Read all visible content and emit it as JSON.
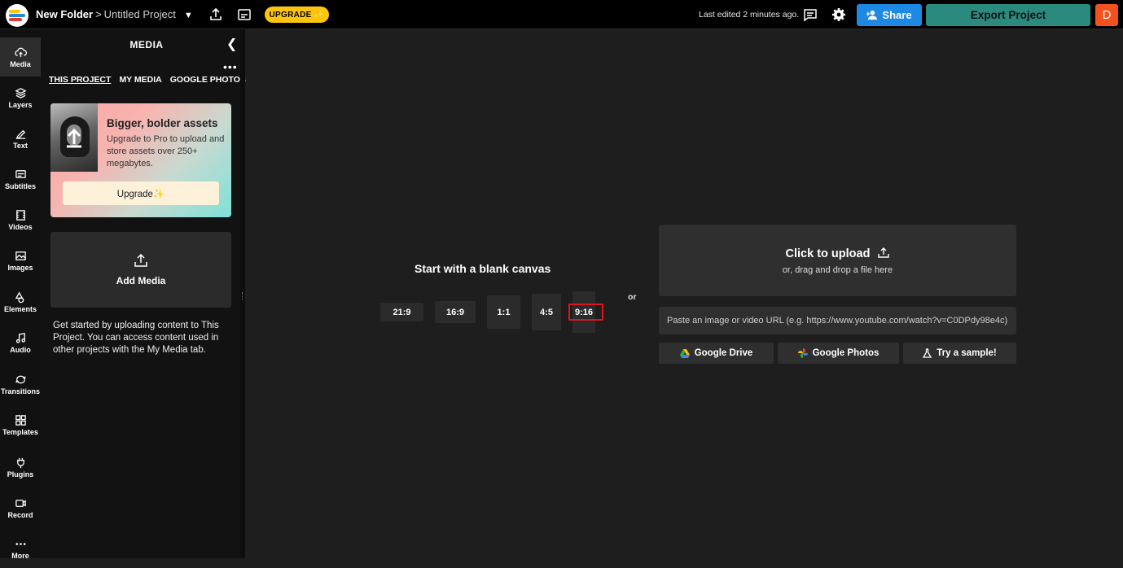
{
  "header": {
    "folder": "New Folder",
    "separator": ">",
    "project": "Untitled Project",
    "upgrade_label": "UPGRADE ✨",
    "last_edited": "Last edited 2 minutes ago.",
    "share_label": "Share",
    "export_label": "Export Project",
    "avatar_initial": "D",
    "colors": {
      "upgrade": "#ffc40c",
      "share": "#1e88e5",
      "export": "#2a8a7e",
      "avatar": "#f4511e"
    }
  },
  "rail": [
    {
      "label": "Media",
      "icon": "media-icon"
    },
    {
      "label": "Layers",
      "icon": "layers-icon"
    },
    {
      "label": "Text",
      "icon": "text-icon"
    },
    {
      "label": "Subtitles",
      "icon": "subtitles-icon"
    },
    {
      "label": "Videos",
      "icon": "videos-icon"
    },
    {
      "label": "Images",
      "icon": "images-icon"
    },
    {
      "label": "Elements",
      "icon": "elements-icon"
    },
    {
      "label": "Audio",
      "icon": "audio-icon"
    },
    {
      "label": "Transitions",
      "icon": "transitions-icon"
    },
    {
      "label": "Templates",
      "icon": "templates-icon"
    },
    {
      "label": "Plugins",
      "icon": "plugins-icon"
    },
    {
      "label": "Record",
      "icon": "record-icon"
    },
    {
      "label": "More",
      "icon": "more-icon"
    }
  ],
  "panel": {
    "title": "MEDIA",
    "tabs": [
      "THIS PROJECT",
      "MY MEDIA",
      "GOOGLE PHOTOS"
    ],
    "promo": {
      "title": "Bigger, bolder assets",
      "description": "Upgrade to Pro to upload and store assets over 250+ megabytes.",
      "button": "Upgrade✨"
    },
    "add_media": "Add Media",
    "help": "Get started by uploading content to This Project. You can access content used in other projects with the My Media tab."
  },
  "canvas": {
    "title": "Start with a blank canvas",
    "ratios": [
      "21:9",
      "16:9",
      "1:1",
      "4:5",
      "9:16"
    ],
    "or": "or"
  },
  "upload": {
    "title": "Click to upload",
    "subtitle": "or, drag and drop a file here",
    "url_placeholder": "Paste an image or video URL (e.g. https://www.youtube.com/watch?v=C0DPdy98e4c)",
    "sources": [
      "Google Drive",
      "Google Photos",
      "Try a sample!"
    ]
  }
}
